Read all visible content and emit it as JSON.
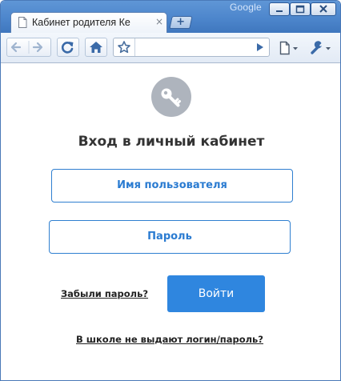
{
  "browser": {
    "brand": "Google",
    "tab_title": "Кабинет родителя Ке",
    "tab_close": "×",
    "new_tab_label": "+",
    "address_value": "",
    "address_placeholder": ""
  },
  "page": {
    "heading": "Вход в личный кабинет",
    "username_placeholder": "Имя пользователя",
    "password_placeholder": "Пароль",
    "forgot_password": "Забыли пароль?",
    "login_button": "Войти",
    "no_credentials_link": "В школе не выдают логин/пароль?"
  },
  "colors": {
    "accent": "#2f86df",
    "field_border": "#2f7fd0",
    "icon_circle": "#aeb4bd",
    "heading_text": "#333333",
    "browser_frame": "#4d86cc"
  },
  "icons": {
    "tab": "page-icon",
    "back": "arrow-left-icon",
    "forward": "arrow-right-icon",
    "reload": "reload-icon",
    "home": "home-icon",
    "bookmark": "star-icon",
    "go": "play-icon",
    "page_menu": "page-menu-icon",
    "settings": "wrench-icon",
    "login": "key-icon"
  }
}
